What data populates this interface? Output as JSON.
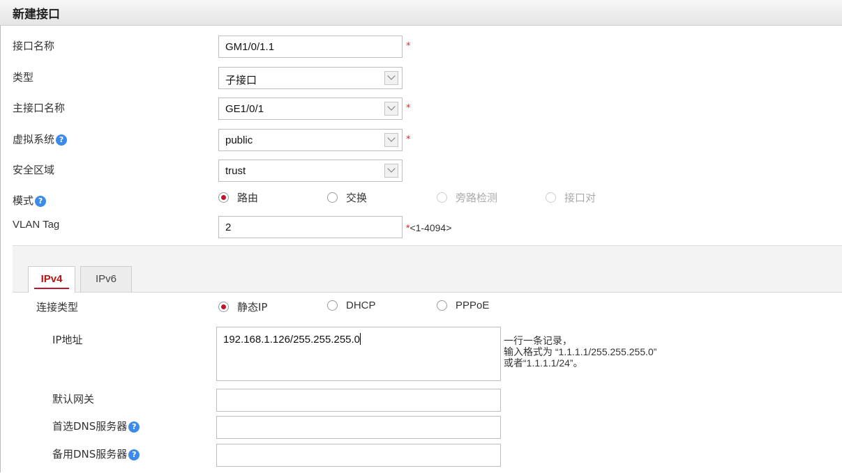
{
  "title": "新建接口",
  "fields": {
    "interface_name": {
      "label": "接口名称",
      "value": "GM1/0/1.1",
      "required": "*"
    },
    "type": {
      "label": "类型",
      "value": "子接口"
    },
    "main_interface": {
      "label": "主接口名称",
      "value": "GE1/0/1",
      "required": "*"
    },
    "virtual_system": {
      "label": "虚拟系统",
      "value": "public",
      "required": "*"
    },
    "security_zone": {
      "label": "安全区域",
      "value": "trust"
    },
    "mode": {
      "label": "模式",
      "options": [
        "路由",
        "交换",
        "旁路检测",
        "接口对"
      ],
      "selected": "路由"
    },
    "vlan_tag": {
      "label": "VLAN Tag",
      "value": "2",
      "required": "*",
      "hint": "<1-4094>"
    }
  },
  "tabs": [
    "IPv4",
    "IPv6"
  ],
  "active_tab": "IPv4",
  "ipv4": {
    "conn_type": {
      "label": "连接类型",
      "options": [
        "静态IP",
        "DHCP",
        "PPPoE"
      ],
      "selected": "静态IP"
    },
    "ip_address": {
      "label": "IP地址",
      "value": "192.168.1.126/255.255.255.0",
      "note": [
        "一行一条记录，",
        "输入格式为 “1.1.1.1/255.255.255.0”",
        "或者“1.1.1.1/24”。"
      ]
    },
    "gateway": {
      "label": "默认网关",
      "value": ""
    },
    "primary_dns": {
      "label": "首选DNS服务器",
      "value": ""
    },
    "secondary_dns": {
      "label": "备用DNS服务器",
      "value": ""
    }
  },
  "help_glyph": "?",
  "colors": {
    "accent": "#c0142c",
    "required": "#e32626",
    "help": "#3d8be8"
  }
}
